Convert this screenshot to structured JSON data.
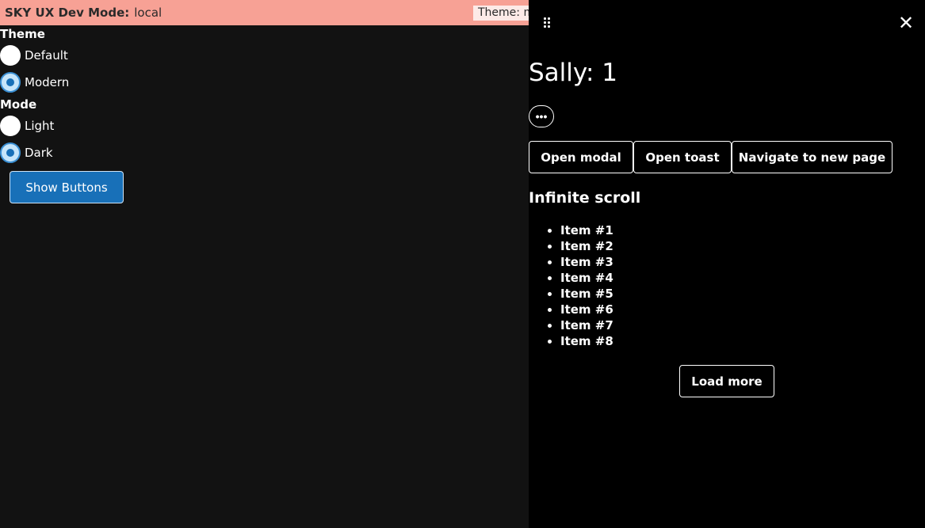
{
  "devbar": {
    "label": "SKY UX Dev Mode:",
    "mode": "local",
    "theme_text": "Theme: modern"
  },
  "settings": {
    "theme_label": "Theme",
    "theme_options": [
      "Default",
      "Modern"
    ],
    "theme_selected": "Modern",
    "mode_label": "Mode",
    "mode_options": [
      "Light",
      "Dark"
    ],
    "mode_selected": "Dark",
    "show_buttons_label": "Show Buttons"
  },
  "panel": {
    "close_glyph": "✕",
    "title": "Sally: 1",
    "more_glyph": "•••",
    "actions": [
      "Open modal",
      "Open toast",
      "Navigate to new page"
    ],
    "section_heading": "Infinite scroll",
    "items": [
      "Item #1",
      "Item #2",
      "Item #3",
      "Item #4",
      "Item #5",
      "Item #6",
      "Item #7",
      "Item #8"
    ],
    "load_more_label": "Load more"
  }
}
